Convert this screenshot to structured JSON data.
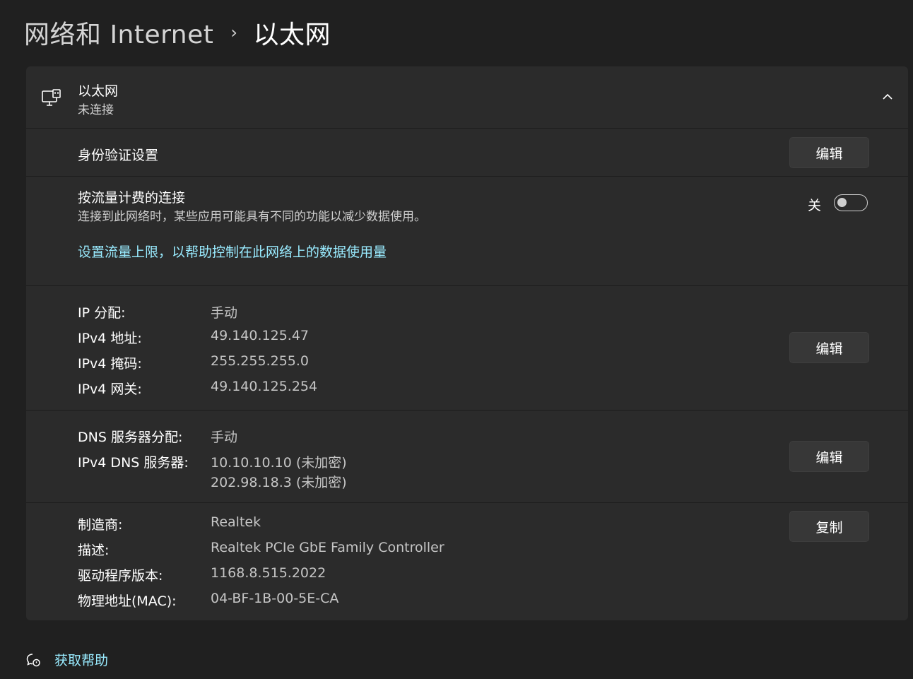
{
  "breadcrumb": {
    "parent": "网络和 Internet",
    "separator": "›",
    "current": "以太网"
  },
  "adapter": {
    "name": "以太网",
    "status": "未连接",
    "icon": "ethernet-monitor-icon",
    "collapse_icon": "chevron-up-icon"
  },
  "auth": {
    "label": "身份验证设置",
    "button": "编辑"
  },
  "metered": {
    "label": "按流量计费的连接",
    "description": "连接到此网络时，某些应用可能具有不同的功能以减少数据使用。",
    "toggle_state": "关",
    "toggle_on": false,
    "link": "设置流量上限，以帮助控制在此网络上的数据使用量"
  },
  "ip": {
    "rows": [
      {
        "key": "IP 分配:",
        "value": "手动"
      },
      {
        "key": "IPv4 地址:",
        "value": "49.140.125.47"
      },
      {
        "key": "IPv4 掩码:",
        "value": "255.255.255.0"
      },
      {
        "key": "IPv4 网关:",
        "value": "49.140.125.254"
      }
    ],
    "button": "编辑"
  },
  "dns": {
    "assignment_key": "DNS 服务器分配:",
    "assignment_value": "手动",
    "servers_key": "IPv4 DNS 服务器:",
    "servers": [
      "10.10.10.10 (未加密)",
      "202.98.18.3 (未加密)"
    ],
    "button": "编辑"
  },
  "hardware": {
    "rows": [
      {
        "key": "制造商:",
        "value": "Realtek"
      },
      {
        "key": "描述:",
        "value": "Realtek PCIe GbE Family Controller"
      },
      {
        "key": "驱动程序版本:",
        "value": "1168.8.515.2022"
      },
      {
        "key": "物理地址(MAC):",
        "value": "04-BF-1B-00-5E-CA"
      }
    ],
    "button": "复制"
  },
  "help": {
    "label": "获取帮助",
    "icon": "help-chat-icon"
  },
  "colors": {
    "background": "#202020",
    "card": "#2b2b2b",
    "link": "#99ebff",
    "button": "#373737"
  }
}
